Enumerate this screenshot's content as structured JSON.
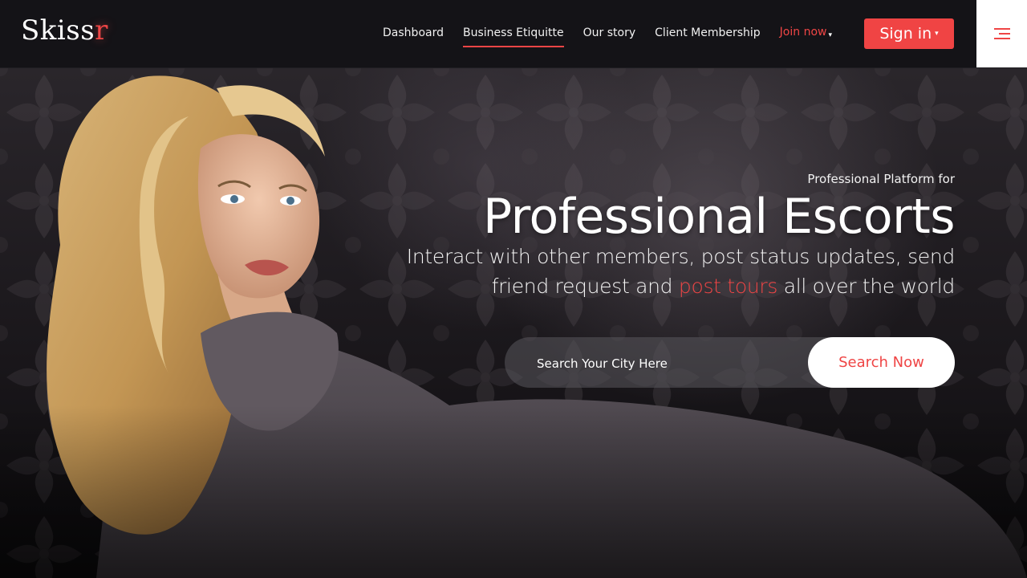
{
  "brand": {
    "name_main": "Skiss",
    "name_accent": "r",
    "accent_color": "#ef4545"
  },
  "nav": {
    "items": [
      {
        "label": "Dashboard",
        "active": false
      },
      {
        "label": "Business Etiquitte",
        "active": true
      },
      {
        "label": "Our story",
        "active": false
      },
      {
        "label": "Client Membership",
        "active": false
      }
    ],
    "join_label": "Join now",
    "signin_label": "Sign in",
    "menu_icon": "hamburger-icon"
  },
  "hero": {
    "eyebrow": "Professional Platform for",
    "headline": "Professional Escorts",
    "subline_before": "Interact with other members, post status updates, send friend request and ",
    "subline_highlight": "post tours",
    "subline_after": " all over the world"
  },
  "search": {
    "placeholder": "Search Your City Here",
    "value": "",
    "button_label": "Search Now"
  },
  "colors": {
    "accent": "#ef4545",
    "header_bg": "#141317",
    "hero_bg": "#1a171b"
  }
}
